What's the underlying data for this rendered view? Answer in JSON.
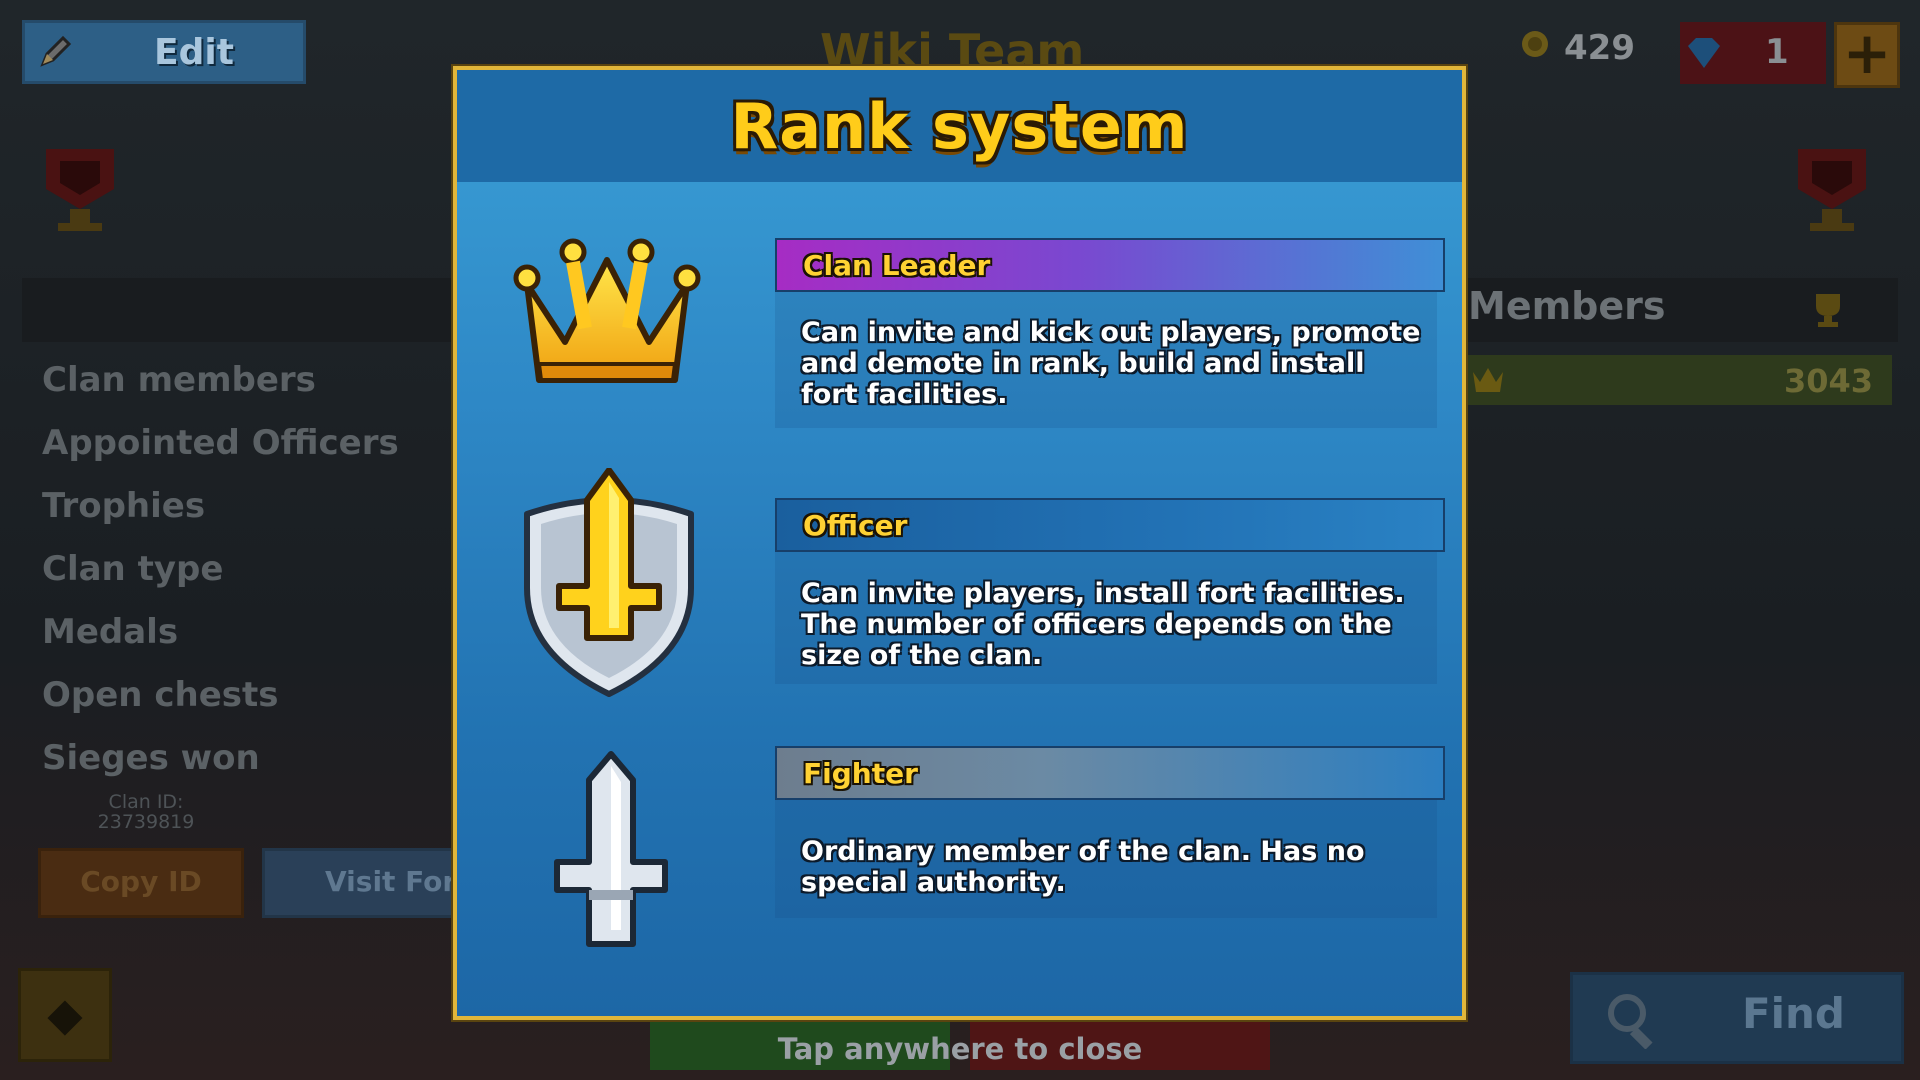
{
  "background": {
    "edit_label": "Edit",
    "clan_title": "Wiki Team",
    "coins": "429",
    "gems": "1",
    "plus_label": "+",
    "members_header": "Members",
    "member_score": "3043",
    "stats": [
      "Clan members",
      "Appointed Officers",
      "Trophies",
      "Clan type",
      "Medals",
      "Open chests",
      "Sieges won"
    ],
    "clan_id_label": "Clan ID:",
    "clan_id_value": "23739819",
    "copy_id_label": "Copy ID",
    "visit_fort_label": "Visit Fort",
    "find_label": "Find",
    "back_label": "◆"
  },
  "modal": {
    "title": "Rank system",
    "ranks": [
      {
        "label": "Clan Leader",
        "icon": "crown-icon",
        "description": "Can invite and kick out players, promote and demote in rank, build and install fort facilities."
      },
      {
        "label": "Officer",
        "icon": "shield-sword-icon",
        "description": "Can invite players, install fort facilities. The number of officers depends on the size of the clan."
      },
      {
        "label": "Fighter",
        "icon": "sword-icon",
        "description": "Ordinary member of the clan. Has no special authority."
      }
    ]
  },
  "footer": {
    "tap_to_close": "Tap anywhere to close"
  },
  "colors": {
    "accent_gold": "#ffcc1a",
    "modal_blue": "#2e88c6",
    "leader_purple": "#a62cc4",
    "border_gold": "#e1b63a"
  }
}
